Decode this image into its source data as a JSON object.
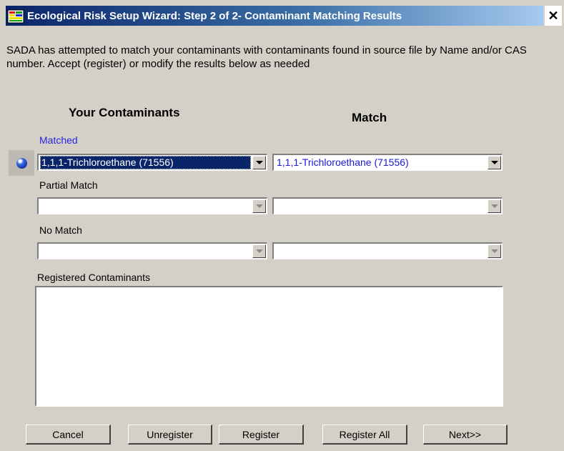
{
  "window": {
    "title": "Ecological Risk Setup Wizard: Step 2 of 2- Contaminant Matching Results",
    "close_symbol": "✕"
  },
  "description": "SADA has attempted to match your contaminants with contaminants found in source file by Name and/or CAS number.  Accept (register) or modify the results below as needed",
  "columns": {
    "left": "Your Contaminants",
    "right": "Match"
  },
  "sections": {
    "matched": {
      "label": "Matched",
      "your_value": "1,1,1-Trichloroethane (71556)",
      "match_value": "1,1,1-Trichloroethane (71556)"
    },
    "partial": {
      "label": "Partial Match",
      "your_value": "",
      "match_value": ""
    },
    "nomatch": {
      "label": "No Match",
      "your_value": "",
      "match_value": ""
    },
    "registered": {
      "label": "Registered Contaminants",
      "items": []
    }
  },
  "buttons": {
    "cancel": "Cancel",
    "unregister": "Unregister",
    "register": "Register",
    "register_all": "Register All",
    "next": "Next>>"
  },
  "icons": {
    "app": "app-wizard-icon",
    "indicator": "blue-ball-icon",
    "dropdown": "chevron-down-icon"
  },
  "colors": {
    "title_gradient_start": "#0a246a",
    "dialog_face": "#d4d0c8",
    "matched_label": "#2424e0",
    "selection": "#0a246a"
  }
}
